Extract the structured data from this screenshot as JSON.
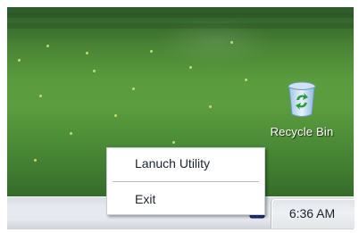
{
  "desktop": {
    "recycle_bin_label": "Recycle Bin"
  },
  "context_menu": {
    "items": [
      {
        "label": "Lanuch Utility"
      },
      {
        "label": "Exit"
      }
    ]
  },
  "taskbar": {
    "clock": "6:36 AM",
    "tray_icon": "utility-tray-icon"
  },
  "colors": {
    "grass": "#5a9b3e",
    "taskbar": "#e5e8ec",
    "menu_bg": "#ffffff"
  }
}
